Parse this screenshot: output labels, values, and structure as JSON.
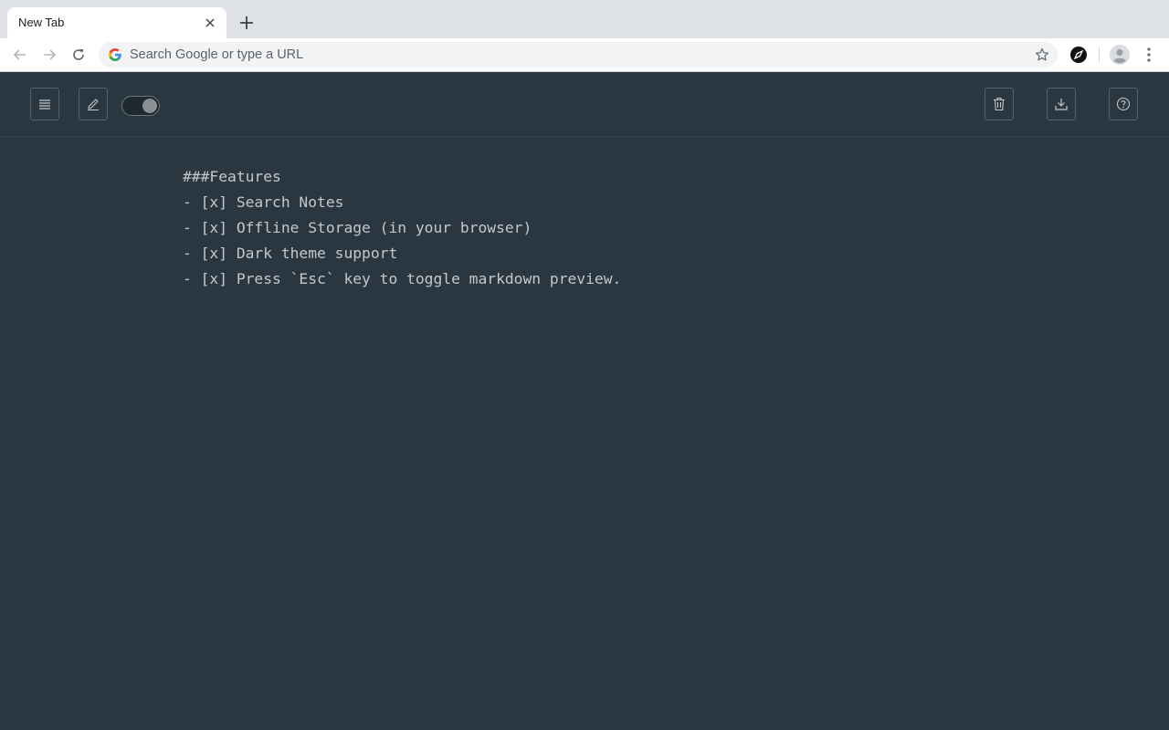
{
  "browser": {
    "tab_title": "New Tab",
    "omnibox_placeholder": "Search Google or type a URL"
  },
  "app": {
    "toggle_state": "on",
    "content_lines": [
      "###Features",
      "- [x] Search Notes",
      "- [x] Offline Storage (in your browser)",
      "- [x] Dark theme support",
      "- [x] Press `Esc` key to toggle markdown preview."
    ]
  },
  "colors": {
    "app_background": "#2a3640",
    "text": "#c3c8cc",
    "button_border": "#55616a",
    "tabstrip": "#dee1e6"
  },
  "icons": {
    "left_buttons": [
      "list-icon",
      "edit-icon"
    ],
    "right_buttons": [
      "trash-icon",
      "download-icon",
      "help-icon"
    ]
  }
}
